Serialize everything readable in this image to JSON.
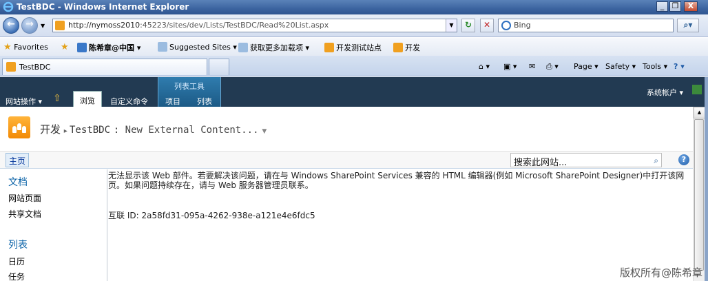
{
  "window": {
    "title": "TestBDC - Windows Internet Explorer",
    "min": "_",
    "max": "❐",
    "close": "X"
  },
  "address": {
    "url_host": "http://nymoss2010",
    "url_rest": ":45223/sites/dev/Lists/TestBDC/Read%20List.aspx",
    "search_placeholder": "Bing"
  },
  "favorites_bar": {
    "favorites_label": "Favorites",
    "items": [
      "陈希章@中国",
      "Suggested Sites",
      "获取更多加载项",
      "开发测试站点",
      "开发"
    ]
  },
  "tabs": {
    "active_tab": "TestBDC"
  },
  "commandbar": {
    "page": "Page",
    "safety": "Safety",
    "tools": "Tools"
  },
  "ribbon": {
    "site_actions": "网站操作",
    "browse": "浏览",
    "custom_commands": "自定义命令",
    "context_group": "列表工具",
    "items_tab": "项目",
    "list_tab": "列表",
    "user": "系统帐户"
  },
  "breadcrumb": {
    "site": "开发",
    "list": "TestBDC",
    "view": "New External Content..."
  },
  "topnav": {
    "home": "主页",
    "search_placeholder": "搜索此网站..."
  },
  "leftnav": {
    "documents_heading": "文档",
    "documents": [
      "网站页面",
      "共享文档"
    ],
    "lists_heading": "列表",
    "lists": [
      "日历",
      "任务"
    ]
  },
  "content": {
    "error_message": "无法显示该 Web 部件。若要解决该问题，请在与 Windows SharePoint Services 兼容的 HTML 编辑器(例如 Microsoft SharePoint Designer)中打开该网页。如果问题持续存在，请与 Web 服务器管理员联系。",
    "correlation_id": "互联 ID: 2a58fd31-095a-4262-938e-a121e4e6fdc5"
  },
  "watermark": "版权所有@陈希章",
  "colors": {
    "ribbon": "#223a52",
    "context_group": "#2f7cae",
    "link": "#0b63a8"
  }
}
